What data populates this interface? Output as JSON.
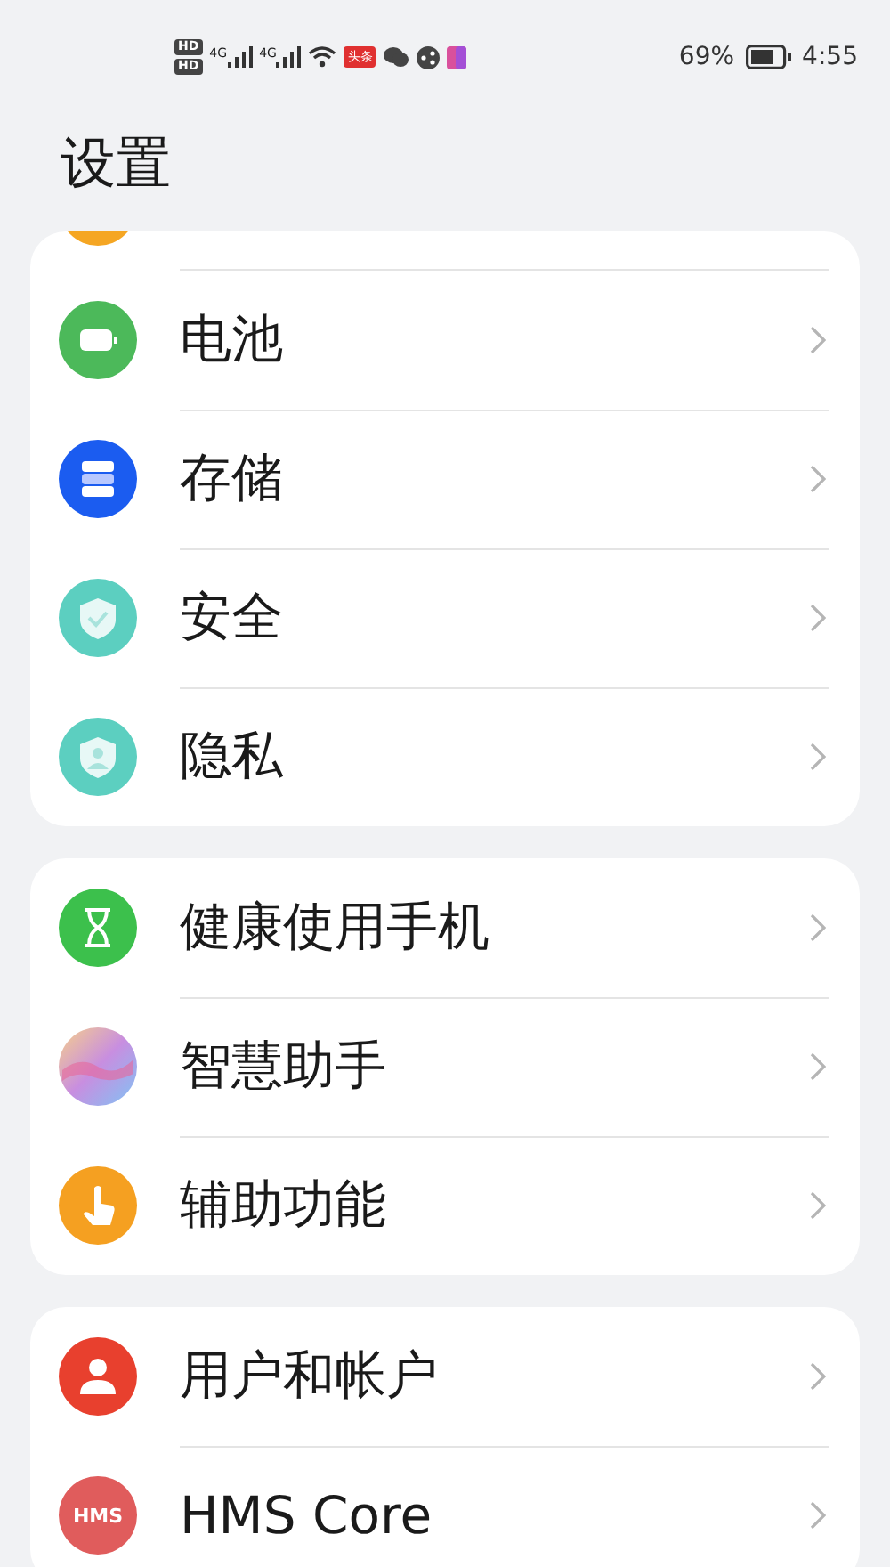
{
  "status_bar": {
    "sim_labels": [
      "HD",
      "HD"
    ],
    "networks": [
      "4G",
      "4G"
    ],
    "app_badge": "头条",
    "battery": "69%",
    "time": "4:55"
  },
  "title": "设置",
  "sections": [
    {
      "peek": {
        "color": "#f5a623"
      },
      "items": [
        {
          "kind": "battery",
          "color": "#4cb95a",
          "label": "电池"
        },
        {
          "kind": "storage",
          "color": "#1b5cf0",
          "label": "存储"
        },
        {
          "kind": "shield-check",
          "color": "#5ccfc0",
          "label": "安全"
        },
        {
          "kind": "shield-person",
          "color": "#5ccfc0",
          "label": "隐私"
        }
      ]
    },
    {
      "items": [
        {
          "kind": "hourglass",
          "color": "#3cc04c",
          "label": "健康使用手机"
        },
        {
          "kind": "orb",
          "color": "#c88ee0",
          "label": "智慧助手"
        },
        {
          "kind": "hand",
          "color": "#f5a021",
          "label": "辅助功能"
        }
      ]
    },
    {
      "items": [
        {
          "kind": "person",
          "color": "#e8402e",
          "label": "用户和帐户"
        },
        {
          "kind": "hms",
          "color": "#e05c5c",
          "label": "HMS Core",
          "icon_text": "HMS"
        }
      ]
    }
  ]
}
